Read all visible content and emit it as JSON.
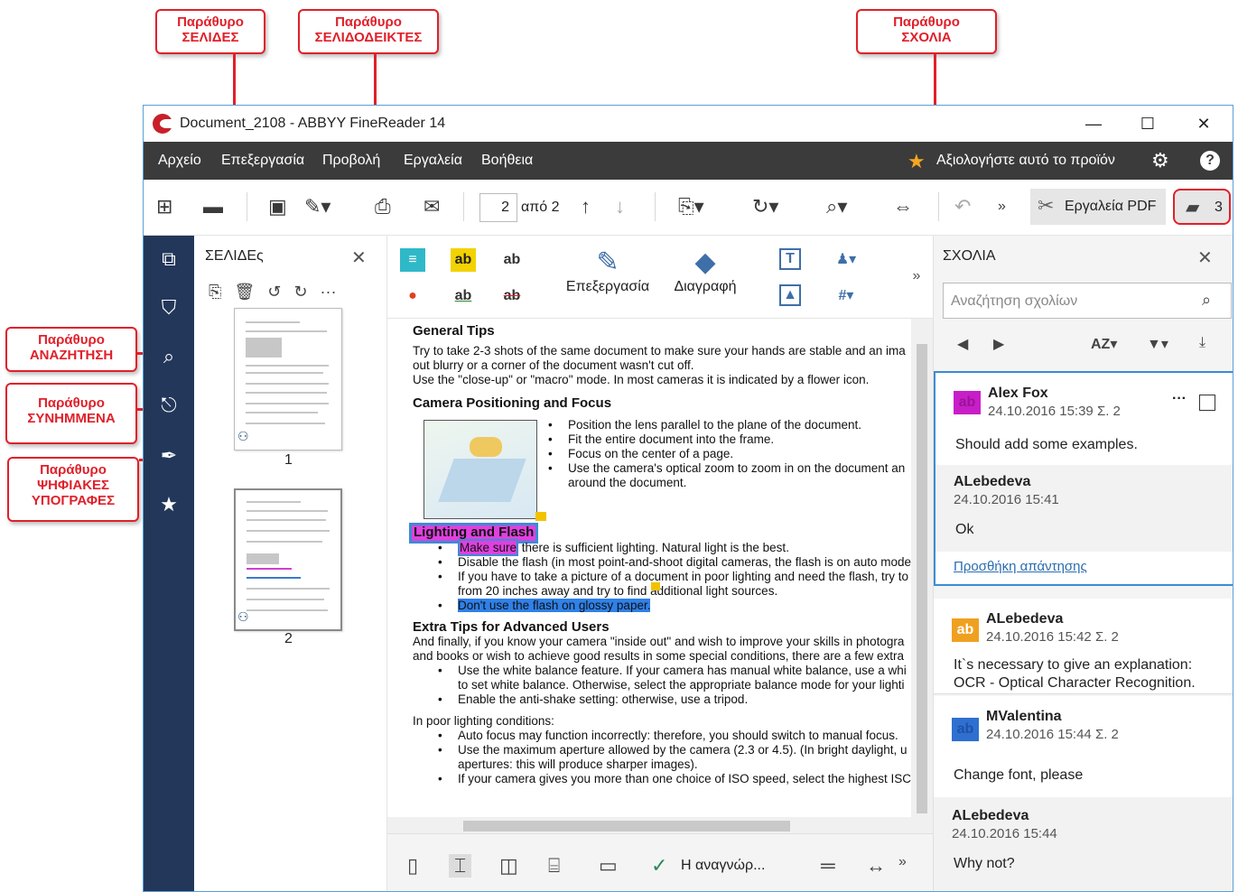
{
  "callouts": {
    "pages": "Παράθυρο\nΣΕΛΙΔΕΣ",
    "bookmarks": "Παράθυρο\nΣΕΛΙΔΟΔΕΙΚΤΕΣ",
    "comments": "Παράθυρο\nΣΧΟΛΙΑ",
    "search": "Παράθυρο\nΑΝΑΖΗΤΗΣΗ",
    "attachments": "Παράθυρο\nΣΥΝΗΜΜΕΝΑ",
    "signatures": "Παράθυρο\nΨΗΦΙΑΚΕΣ\nΥΠΟΓΡΑΦΕΣ"
  },
  "window": {
    "title": "Document_2108 - ABBYY FineReader 14"
  },
  "menu": {
    "items": [
      "Αρχείο",
      "Επεξεργασία",
      "Προβολή",
      "Εργαλεία",
      "Βοήθεια"
    ],
    "rate": "Αξιολογήστε αυτό το προϊόν"
  },
  "toolbar": {
    "page_current": "2",
    "page_of": "από 2",
    "more": "»",
    "pdf_tools": "Εργαλεία PDF",
    "comments_count": "3"
  },
  "pages_panel": {
    "title": "ΣΕΛΙΔΕς",
    "thumbs": [
      "1",
      "2"
    ]
  },
  "ribbon": {
    "edit_label": "Επεξεργασία",
    "erase_label": "Διαγραφή",
    "ab": "ab",
    "more": "»"
  },
  "document": {
    "h_general": "General Tips",
    "p1": "Try to take 2-3 shots of the same document to make sure your hands are stable and an ima",
    "p2": "out blurry or a corner of the document wasn't cut off.",
    "p3": "Use the \"close-up\" or \"macro\" mode. In most cameras it is indicated by a flower icon.",
    "h_camera": "Camera Positioning and Focus",
    "cam_bullets": [
      "Position the lens parallel to the plane of the document.",
      "Fit the entire document into the frame.",
      "Focus on the center of a page.",
      "Use the camera's optical zoom to zoom in on the document an",
      "around the document."
    ],
    "h_light": "Lighting and Flash",
    "light_make_sure": "Make sure",
    "light_b1_rest": " there is sufficient lighting. Natural light is the best.",
    "light_b2": "Disable the flash (in most point-and-shoot digital cameras, the flash is on auto mode",
    "light_b3a": "If you have to take a picture of a document in poor lighting and need the flash, try to",
    "light_b3b": "from 20 inches away and try to find additional light sources.",
    "light_b4": "Don't use the flash on glossy paper.",
    "h_extra": "Extra Tips for Advanced Users",
    "extra_p1": "And finally, if you know your camera \"inside out\" and wish to improve your skills in photogra",
    "extra_p2": "and books or wish to achieve good results in some special conditions, there are a few extra",
    "extra_b1a": "Use the white balance feature. If your camera has manual white balance, use a whi",
    "extra_b1b": "to set white balance. Otherwise, select the appropriate balance mode for your lighti",
    "extra_b2": "Enable the anti-shake setting: otherwise, use a tripod.",
    "poor": "In poor lighting conditions:",
    "poor_b1": "Auto focus may function incorrectly: therefore, you should switch to manual focus.",
    "poor_b2a": "Use the maximum aperture allowed by the camera (2.3 or 4.5). (In bright daylight, u",
    "poor_b2b": "apertures: this will produce sharper images).",
    "poor_b3": "If your camera gives you more than one choice of ISO speed, select the highest ISC"
  },
  "bottombar": {
    "status": "Η αναγνώρ...",
    "more": "»"
  },
  "comments_panel": {
    "title": "ΣΧΟΛΙΑ",
    "search_placeholder": "Αναζήτηση σχολίων",
    "sort_label": "AZ",
    "cards": [
      {
        "author": "Alex Fox",
        "meta": "24.10.2016 15:39  Σ. 2",
        "text": "Should add some examples.",
        "badge": "ab",
        "badge_color": "#c81ec8"
      },
      {
        "author": "ALebedeva",
        "meta": "24.10.2016 15:41",
        "text": "Ok"
      },
      {
        "reply": "Προσθήκη απάντησης"
      },
      {
        "author": "ALebedeva",
        "meta": "24.10.2016 15:42  Σ. 2",
        "text": "It`s necessary to give an explanation:\nOCR - Optical Character Recognition.",
        "badge": "ab",
        "badge_color": "#f0a020"
      },
      {
        "author": "MValentina",
        "meta": "24.10.2016 15:44  Σ. 2",
        "text": "Change font, please",
        "badge": "ab",
        "badge_color": "#2f6fd0"
      },
      {
        "author": "ALebedeva",
        "meta": "24.10.2016 15:44",
        "text": "Why not?"
      }
    ]
  },
  "colors": {
    "accent_red": "#e0202a",
    "nav_bg": "#22375a",
    "menu_bg": "#3b3b3b",
    "focus_blue": "#3e8bd2"
  }
}
